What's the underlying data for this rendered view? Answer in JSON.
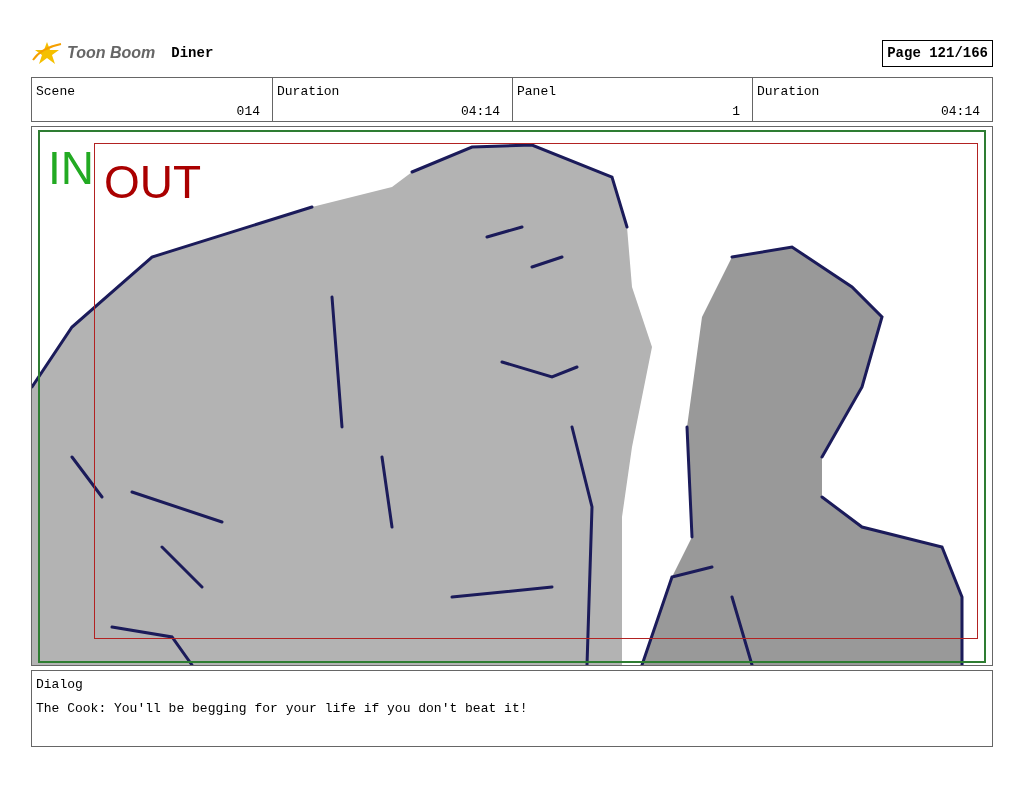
{
  "header": {
    "logo": "Toon Boom",
    "title": "Diner",
    "page": "Page 121/166"
  },
  "info": [
    {
      "label": "Scene",
      "value": "014"
    },
    {
      "label": "Duration",
      "value": "04:14"
    },
    {
      "label": "Panel",
      "value": "1"
    },
    {
      "label": "Duration",
      "value": "04:14"
    }
  ],
  "panel": {
    "in_label": "IN",
    "out_label": "OUT"
  },
  "dialog": {
    "label": "Dialog",
    "text": "The Cook: You'll be begging for your life if you don't beat it!"
  }
}
